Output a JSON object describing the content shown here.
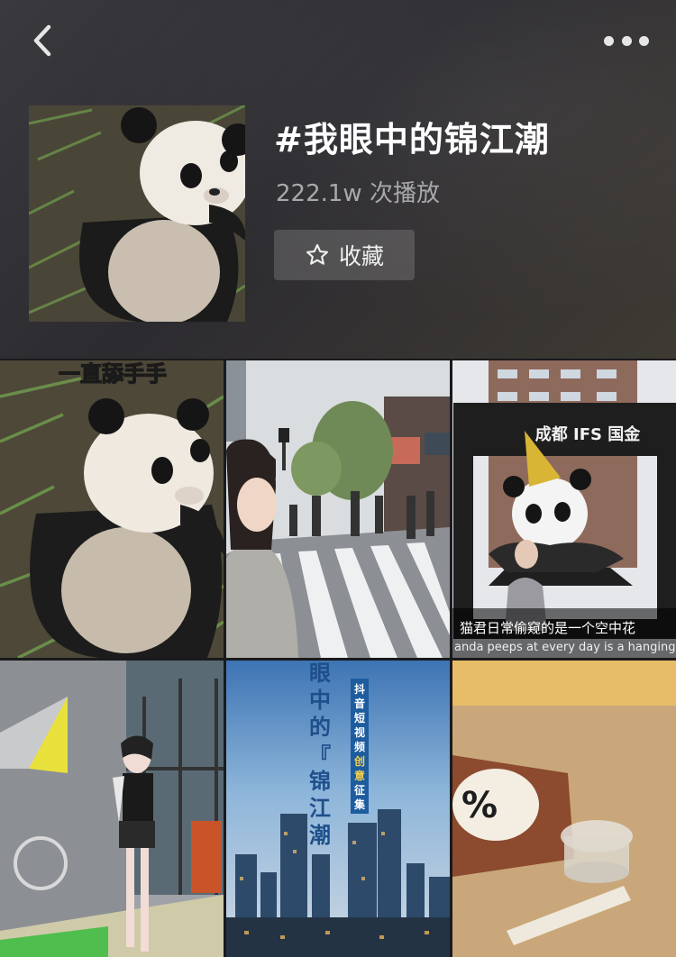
{
  "topbar": {
    "back_icon": "chevron-left-icon",
    "more_icon": "more-horizontal-icon"
  },
  "topic": {
    "title": "#我眼中的锦江潮",
    "plays": "222.1w 次播放",
    "favorite_label": "收藏",
    "favorite_icon": "star-outline-icon"
  },
  "videos": [
    {
      "caption": "一直舔手手"
    },
    {
      "caption": ""
    },
    {
      "sign": "成都 IFS 国金",
      "caption_cn": "猫君日常偷窥的是一个空中花",
      "caption_en": "anda peeps at every day is a hanging"
    },
    {
      "caption": ""
    },
    {
      "vertical_title": "眼中的『锦江潮』",
      "banner": "抖音短视频创意征集令"
    },
    {
      "caption": ""
    }
  ]
}
